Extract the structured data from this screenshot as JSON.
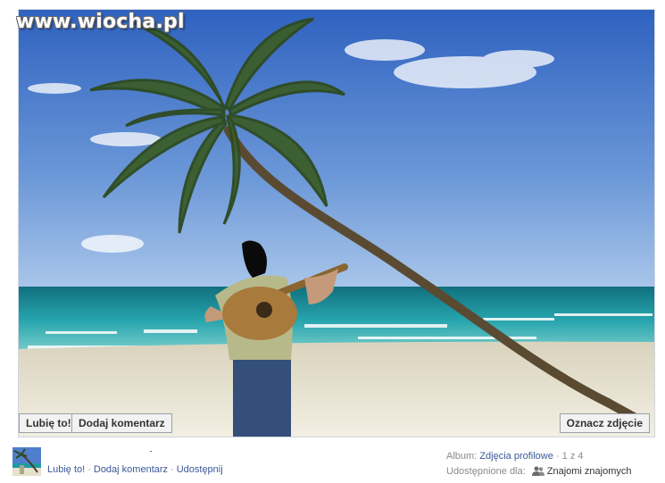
{
  "watermark": "www.wiocha.pl",
  "photo": {
    "description_icon": "beach-photo"
  },
  "overlay_buttons": {
    "like": "Lubię to!",
    "comment": "Dodaj komentarz",
    "tag": "Oznacz zdjęcie"
  },
  "footer": {
    "actions": {
      "like": "Lubię to!",
      "comment": "Dodaj komentarz",
      "share": "Udostępnij",
      "separator": "·"
    },
    "album": {
      "label": "Album:",
      "name": "Zdjęcia profilowe",
      "position": "· 1 z 4"
    },
    "shared": {
      "label": "Udostępnione dla:",
      "audience": "Znajomi znajomych",
      "icon": "people-icon"
    }
  },
  "colors": {
    "link": "#3b5998",
    "muted": "#8a8a8a",
    "sky": "#3d6fc4",
    "sea": "#1e9aa6",
    "sand": "#ece6d4"
  }
}
